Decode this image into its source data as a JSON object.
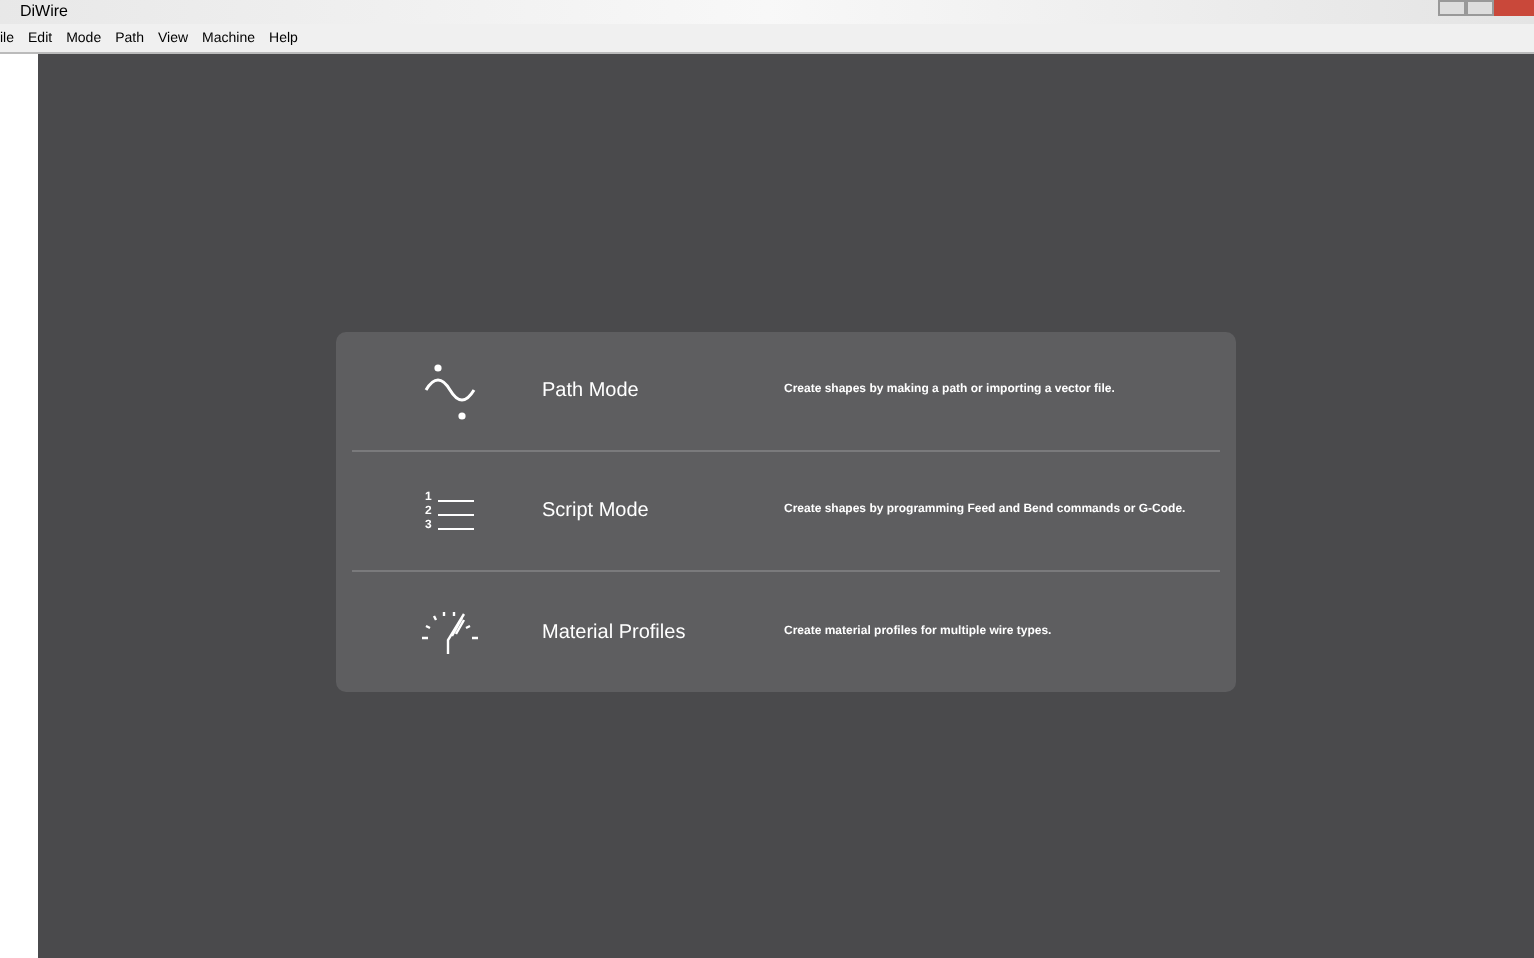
{
  "window": {
    "title": "DiWire"
  },
  "menu": [
    "ile",
    "Edit",
    "Mode",
    "Path",
    "View",
    "Machine",
    "Help"
  ],
  "modes": [
    {
      "kind": "path",
      "title": "Path Mode",
      "description": "Create shapes by making a path or importing a vector file."
    },
    {
      "kind": "script",
      "title": "Script Mode",
      "description": "Create shapes by programming Feed and Bend commands or G-Code.",
      "numbers": [
        "1",
        "2",
        "3"
      ]
    },
    {
      "kind": "material",
      "title": "Material Profiles",
      "description": "Create material profiles for multiple wire types."
    }
  ]
}
